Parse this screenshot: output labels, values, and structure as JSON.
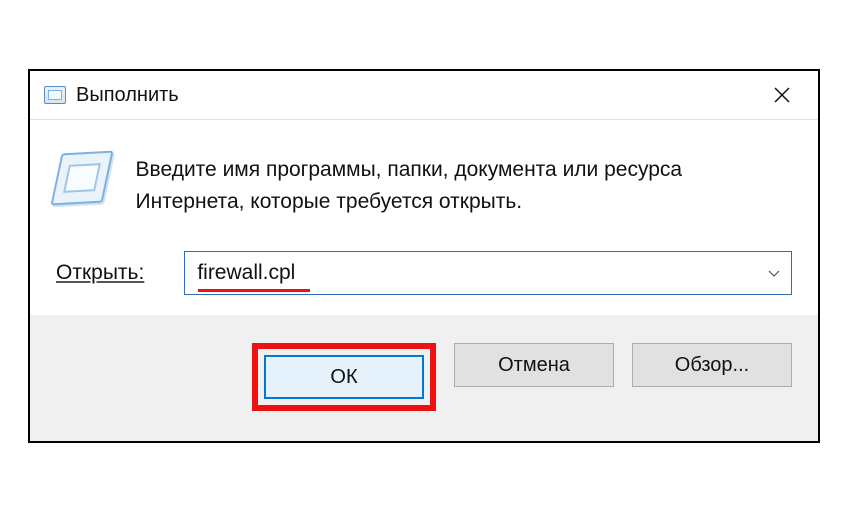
{
  "titlebar": {
    "title": "Выполнить"
  },
  "body": {
    "instruction": "Введите имя программы, папки, документа или ресурса Интернета, которые требуется открыть.",
    "open_label": "Открыть:",
    "input_value": "firewall.cpl"
  },
  "buttons": {
    "ok": "ОК",
    "cancel": "Отмена",
    "browse": "Обзор..."
  }
}
